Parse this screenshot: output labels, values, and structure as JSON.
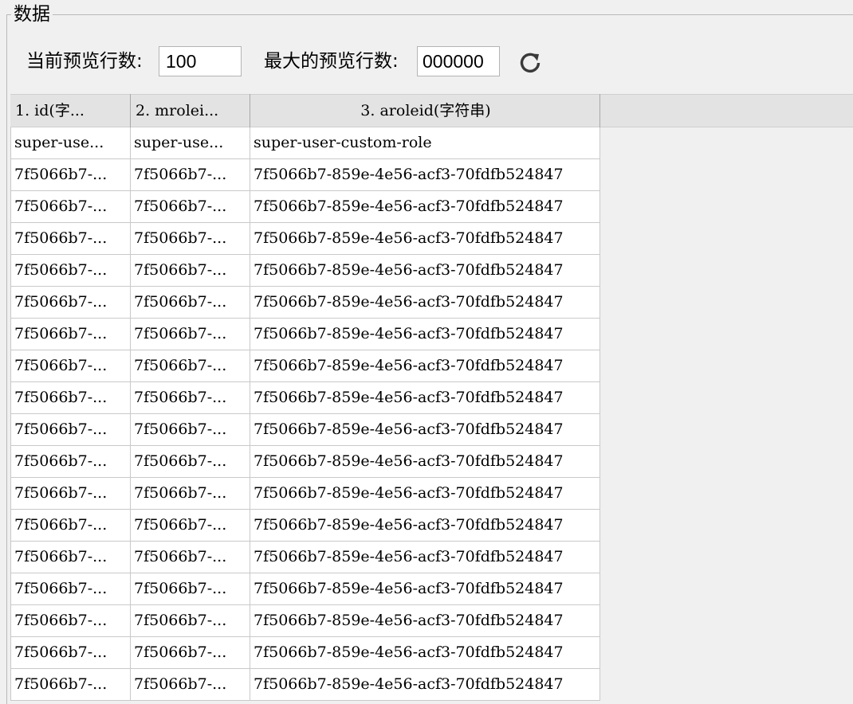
{
  "group": {
    "title": "数据"
  },
  "controls": {
    "current_preview_label": "当前预览行数:",
    "current_preview_value": "100",
    "max_preview_label": "最大的预览行数:",
    "max_preview_value": "000000",
    "refresh_icon": "refresh-icon"
  },
  "table": {
    "columns": [
      {
        "label": "1. id(字..."
      },
      {
        "label": "2. mrolei..."
      },
      {
        "label": "3. aroleid(字符串)"
      }
    ],
    "rows": [
      [
        "super-use...",
        "super-use...",
        "super-user-custom-role"
      ],
      [
        "7f5066b7-...",
        "7f5066b7-...",
        "7f5066b7-859e-4e56-acf3-70fdfb524847"
      ],
      [
        "7f5066b7-...",
        "7f5066b7-...",
        "7f5066b7-859e-4e56-acf3-70fdfb524847"
      ],
      [
        "7f5066b7-...",
        "7f5066b7-...",
        "7f5066b7-859e-4e56-acf3-70fdfb524847"
      ],
      [
        "7f5066b7-...",
        "7f5066b7-...",
        "7f5066b7-859e-4e56-acf3-70fdfb524847"
      ],
      [
        "7f5066b7-...",
        "7f5066b7-...",
        "7f5066b7-859e-4e56-acf3-70fdfb524847"
      ],
      [
        "7f5066b7-...",
        "7f5066b7-...",
        "7f5066b7-859e-4e56-acf3-70fdfb524847"
      ],
      [
        "7f5066b7-...",
        "7f5066b7-...",
        "7f5066b7-859e-4e56-acf3-70fdfb524847"
      ],
      [
        "7f5066b7-...",
        "7f5066b7-...",
        "7f5066b7-859e-4e56-acf3-70fdfb524847"
      ],
      [
        "7f5066b7-...",
        "7f5066b7-...",
        "7f5066b7-859e-4e56-acf3-70fdfb524847"
      ],
      [
        "7f5066b7-...",
        "7f5066b7-...",
        "7f5066b7-859e-4e56-acf3-70fdfb524847"
      ],
      [
        "7f5066b7-...",
        "7f5066b7-...",
        "7f5066b7-859e-4e56-acf3-70fdfb524847"
      ],
      [
        "7f5066b7-...",
        "7f5066b7-...",
        "7f5066b7-859e-4e56-acf3-70fdfb524847"
      ],
      [
        "7f5066b7-...",
        "7f5066b7-...",
        "7f5066b7-859e-4e56-acf3-70fdfb524847"
      ],
      [
        "7f5066b7-...",
        "7f5066b7-...",
        "7f5066b7-859e-4e56-acf3-70fdfb524847"
      ],
      [
        "7f5066b7-...",
        "7f5066b7-...",
        "7f5066b7-859e-4e56-acf3-70fdfb524847"
      ],
      [
        "7f5066b7-...",
        "7f5066b7-...",
        "7f5066b7-859e-4e56-acf3-70fdfb524847"
      ],
      [
        "7f5066b7-...",
        "7f5066b7-...",
        "7f5066b7-859e-4e56-acf3-70fdfb524847"
      ]
    ]
  }
}
